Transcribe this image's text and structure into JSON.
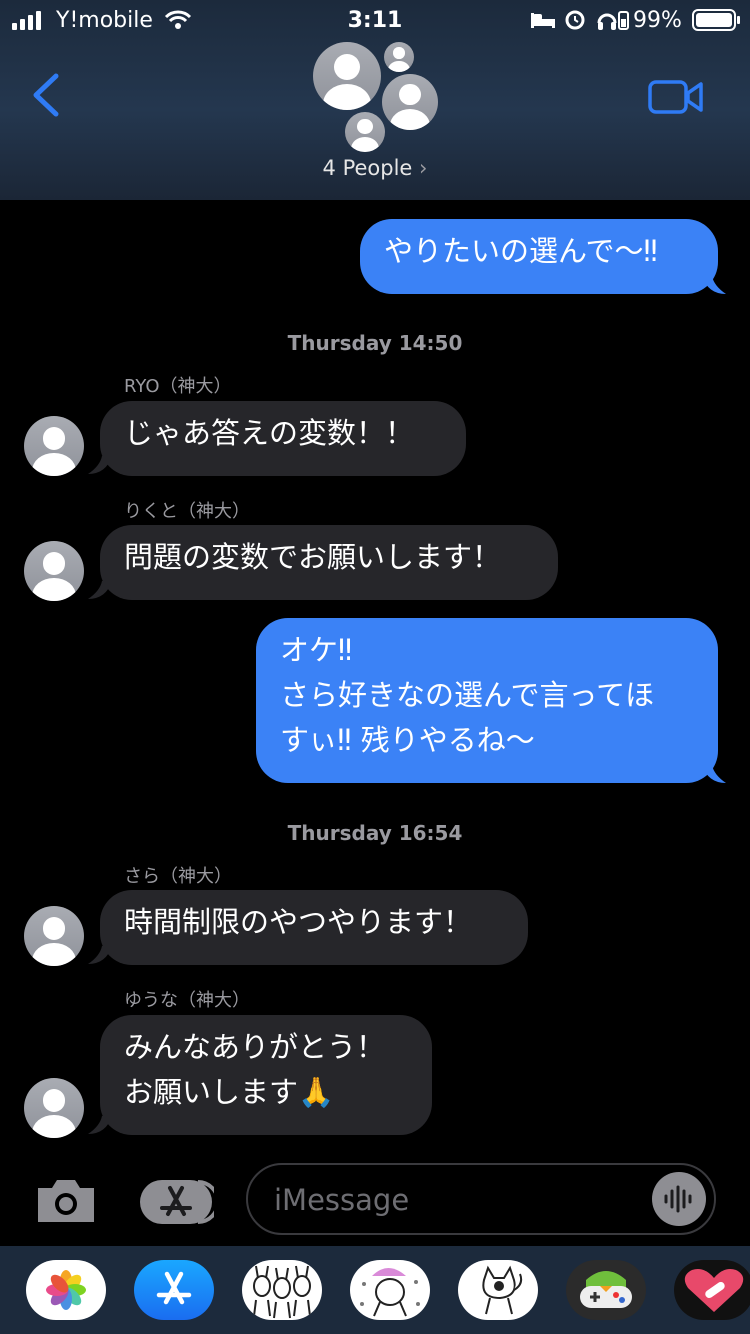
{
  "status_bar": {
    "carrier": "Y!mobile",
    "time": "3:11",
    "battery_pct": "99%"
  },
  "header": {
    "group_label": "4 People",
    "chevron": "›"
  },
  "thread": [
    {
      "type": "out",
      "text": "やりたいの選んで〜‼︎"
    },
    {
      "type": "timestamp",
      "text": "Thursday 14:50"
    },
    {
      "type": "in",
      "sender": "RYO（神大）",
      "text": "じゃあ答えの変数！！"
    },
    {
      "type": "in",
      "sender": "りくと（神大）",
      "text": "問題の変数でお願いします！"
    },
    {
      "type": "out",
      "text": "オケ‼︎\nさら好きなの選んで言ってほ\nすぃ‼︎ 残りやるね〜"
    },
    {
      "type": "timestamp",
      "text": "Thursday 16:54"
    },
    {
      "type": "in",
      "sender": "さら（神大）",
      "text": "時間制限のやつやります！"
    },
    {
      "type": "in",
      "sender": "ゆうな（神大）",
      "text": "みんなありがとう！\nお願いします🙏"
    }
  ],
  "composer": {
    "placeholder": "iMessage"
  },
  "app_drawer": [
    {
      "name": "photos-app-icon"
    },
    {
      "name": "app-store-icon"
    },
    {
      "name": "sticker-pack-1-icon"
    },
    {
      "name": "sticker-pack-2-icon"
    },
    {
      "name": "sticker-pack-3-icon"
    },
    {
      "name": "game-app-icon"
    },
    {
      "name": "heart-app-icon"
    }
  ],
  "colors": {
    "outgoing_bubble": "#3b82f6",
    "incoming_bubble": "#26262a",
    "accent": "#2f7bf5"
  }
}
